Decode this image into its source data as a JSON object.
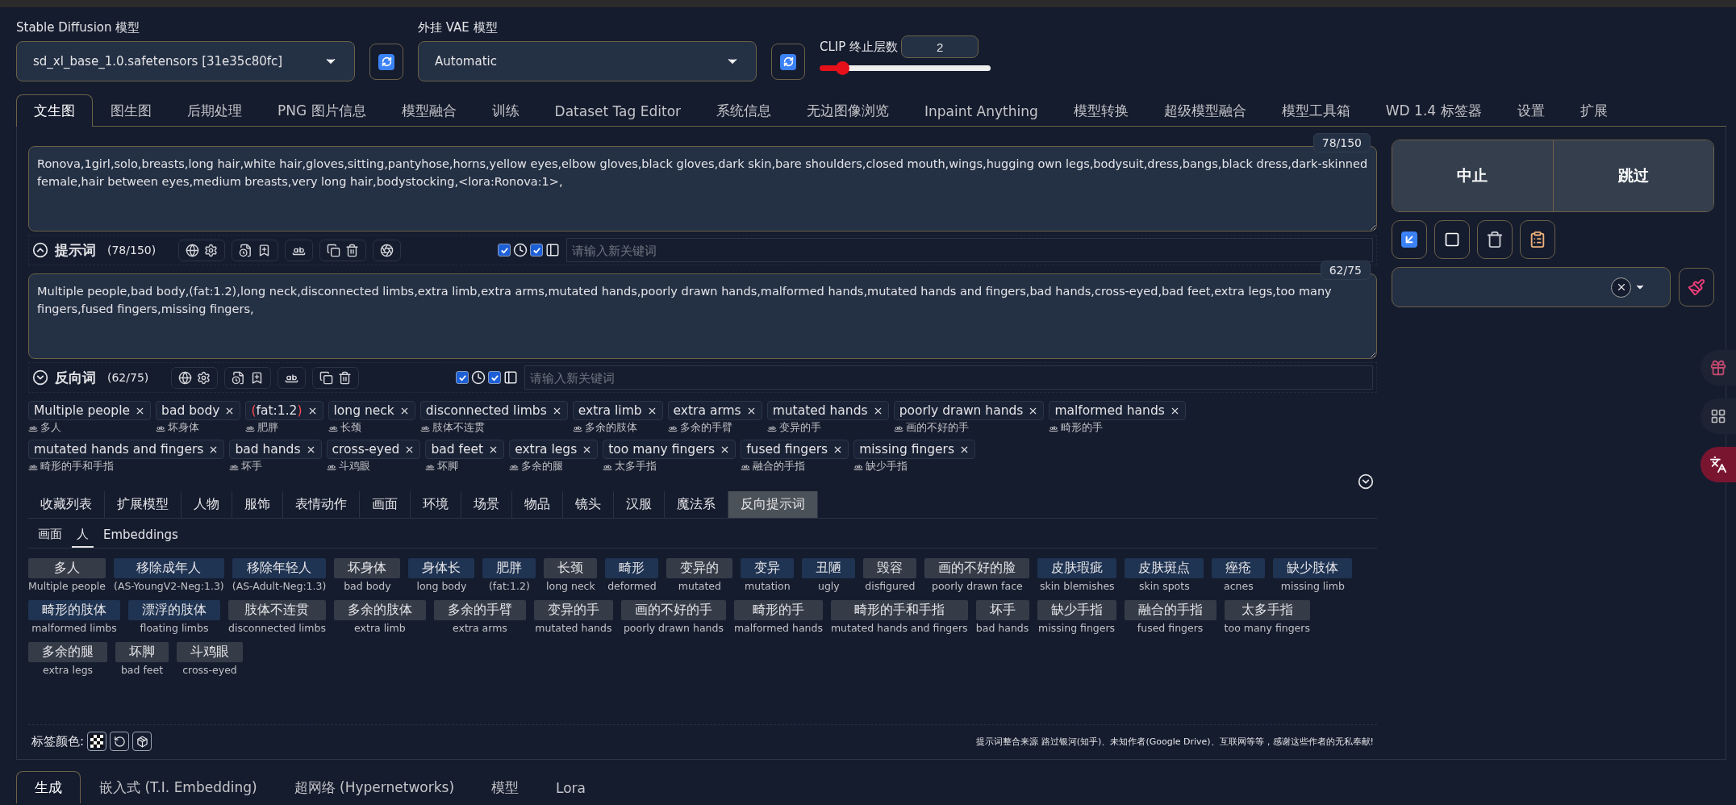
{
  "models": [
    {
      "label": "Stable Diffusion 模型",
      "value": "sd_xl_base_1.0.safetensors [31e35c80fc]"
    },
    {
      "label": "外挂 VAE 模型",
      "value": "Automatic"
    }
  ],
  "clip": {
    "label": "CLIP 终止层数",
    "value": "2",
    "level": 0.1
  },
  "tabs": [
    {
      "label": "文生图",
      "selected": true
    },
    {
      "label": "图生图",
      "selected": false
    },
    {
      "label": "后期处理",
      "selected": false
    },
    {
      "label": "PNG 图片信息",
      "selected": false
    },
    {
      "label": "模型融合",
      "selected": false
    },
    {
      "label": "训练",
      "selected": false
    },
    {
      "label": "Dataset Tag Editor",
      "selected": false
    },
    {
      "label": "系统信息",
      "selected": false
    },
    {
      "label": "无边图像浏览",
      "selected": false
    },
    {
      "label": "Inpaint Anything",
      "selected": false
    },
    {
      "label": "模型转换",
      "selected": false
    },
    {
      "label": "超级模型融合",
      "selected": false
    },
    {
      "label": "模型工具箱",
      "selected": false
    },
    {
      "label": "WD 1.4 标签器",
      "selected": false
    },
    {
      "label": "设置",
      "selected": false
    },
    {
      "label": "扩展",
      "selected": false
    }
  ],
  "prompts": [
    {
      "text": "Ronova,1girl,solo,breasts,long hair,white hair,gloves,sitting,pantyhose,horns,yellow eyes,elbow gloves,black gloves,dark skin,bare shoulders,closed mouth,wings,hugging own legs,bodysuit,dress,bangs,black dress,dark-skinned female,hair between eyes,medium breasts,very long hair,bodystocking,<lora:Ronova:1>,",
      "counter": "78/150",
      "title": "提示词",
      "count": "(78/150)",
      "expanded": true,
      "tool_groups": [
        [
          {
            "kind": "globe"
          },
          {
            "kind": "gear"
          }
        ],
        [
          {
            "kind": "history"
          },
          {
            "kind": "bookmark"
          }
        ],
        [
          {
            "kind": "ab"
          }
        ],
        [
          {
            "kind": "copy"
          },
          {
            "kind": "trash"
          }
        ],
        [
          {
            "kind": "openai"
          }
        ]
      ],
      "toggles": [
        {
          "kind": "clock",
          "checked": true
        },
        {
          "kind": "panel",
          "checked": true
        }
      ],
      "placeholder": "请输入新关键词"
    },
    {
      "text": "Multiple people,bad body,(fat:1.2),long neck,disconnected limbs,extra limb,extra arms,mutated hands,poorly drawn hands,malformed hands,mutated hands and fingers,bad hands,cross-eyed,bad feet,extra legs,too many fingers,fused fingers,missing fingers,",
      "counter": "62/75",
      "title": "反向词",
      "count": "(62/75)",
      "expanded": false,
      "tool_groups": [
        [
          {
            "kind": "globe"
          },
          {
            "kind": "gear"
          }
        ],
        [
          {
            "kind": "history"
          },
          {
            "kind": "bookmark"
          }
        ],
        [
          {
            "kind": "ab"
          }
        ],
        [
          {
            "kind": "copy"
          },
          {
            "kind": "trash"
          }
        ]
      ],
      "toggles": [
        {
          "kind": "clock",
          "checked": true
        },
        {
          "kind": "panel",
          "checked": true
        }
      ],
      "placeholder": "请输入新关键词"
    }
  ],
  "tags": [
    {
      "text": "Multiple people",
      "translation": "多人",
      "weighted": false
    },
    {
      "text": "bad body",
      "translation": "坏身体",
      "weighted": false
    },
    {
      "text": "(fat:1.2)",
      "translation": "肥胖",
      "weighted": true
    },
    {
      "text": "long neck",
      "translation": "长颈",
      "weighted": false
    },
    {
      "text": "disconnected limbs",
      "translation": "肢体不连贯",
      "weighted": false
    },
    {
      "text": "extra limb",
      "translation": "多余的肢体",
      "weighted": false
    },
    {
      "text": "extra arms",
      "translation": "多余的手臂",
      "weighted": false
    },
    {
      "text": "mutated hands",
      "translation": "变异的手",
      "weighted": false
    },
    {
      "text": "poorly drawn hands",
      "translation": "画的不好的手",
      "weighted": false
    },
    {
      "text": "malformed hands",
      "translation": "畸形的手",
      "weighted": false
    },
    {
      "text": "mutated hands and fingers",
      "translation": "畸形的手和手指",
      "weighted": false
    },
    {
      "text": "bad hands",
      "translation": "坏手",
      "weighted": false
    },
    {
      "text": "cross-eyed",
      "translation": "斗鸡眼",
      "weighted": false
    },
    {
      "text": "bad feet",
      "translation": "坏脚",
      "weighted": false
    },
    {
      "text": "extra legs",
      "translation": "多余的腿",
      "weighted": false
    },
    {
      "text": "too many fingers",
      "translation": "太多手指",
      "weighted": false
    },
    {
      "text": "fused fingers",
      "translation": "融合的手指",
      "weighted": false
    },
    {
      "text": "missing fingers",
      "translation": "缺少手指",
      "weighted": false
    }
  ],
  "categories": [
    {
      "label": "收藏列表",
      "selected": false
    },
    {
      "label": "扩展模型",
      "selected": false
    },
    {
      "label": "人物",
      "selected": false
    },
    {
      "label": "服饰",
      "selected": false
    },
    {
      "label": "表情动作",
      "selected": false
    },
    {
      "label": "画面",
      "selected": false
    },
    {
      "label": "环境",
      "selected": false
    },
    {
      "label": "场景",
      "selected": false
    },
    {
      "label": "物品",
      "selected": false
    },
    {
      "label": "镜头",
      "selected": false
    },
    {
      "label": "汉服",
      "selected": false
    },
    {
      "label": "魔法系",
      "selected": false
    },
    {
      "label": "反向提示词",
      "selected": true
    }
  ],
  "subtabs": [
    {
      "label": "画面",
      "selected": false
    },
    {
      "label": "人",
      "selected": true
    },
    {
      "label": "Embeddings",
      "selected": false
    }
  ],
  "grid": [
    {
      "label": "多人",
      "translation": "Multiple people",
      "color": "#353c48"
    },
    {
      "label": "移除成年人",
      "translation": "(AS-YoungV2-Neg:1.3)",
      "color": "#1f3352"
    },
    {
      "label": "移除年轻人",
      "translation": "(AS-Adult-Neg:1.3)",
      "color": "#1f3352"
    },
    {
      "label": "坏身体",
      "translation": "bad body",
      "color": "#353c48"
    },
    {
      "label": "身体长",
      "translation": "long body",
      "color": "#1f3352"
    },
    {
      "label": "肥胖",
      "translation": "(fat:1.2)",
      "color": "#1f3352"
    },
    {
      "label": "长颈",
      "translation": "long neck",
      "color": "#353c48"
    },
    {
      "label": "畸形",
      "translation": "deformed",
      "color": "#1f3352"
    },
    {
      "label": "变异的",
      "translation": "mutated",
      "color": "#353c48"
    },
    {
      "label": "变异",
      "translation": "mutation",
      "color": "#1f3352"
    },
    {
      "label": "丑陋",
      "translation": "ugly",
      "color": "#1f3352"
    },
    {
      "label": "毁容",
      "translation": "disfigured",
      "color": "#353c48"
    },
    {
      "label": "画的不好的脸",
      "translation": "poorly drawn face",
      "color": "#353c48"
    },
    {
      "label": "皮肤瑕疵",
      "translation": "skin blemishes",
      "color": "#1f3352"
    },
    {
      "label": "皮肤斑点",
      "translation": "skin spots",
      "color": "#1f3352"
    },
    {
      "label": "痤疮",
      "translation": "acnes",
      "color": "#1f3352"
    },
    {
      "label": "缺少肢体",
      "translation": "missing limb",
      "color": "#1f3352"
    },
    {
      "label": "畸形的肢体",
      "translation": "malformed limbs",
      "color": "#1f3352"
    },
    {
      "label": "漂浮的肢体",
      "translation": "floating limbs",
      "color": "#1f3352"
    },
    {
      "label": "肢体不连贯",
      "translation": "disconnected limbs",
      "color": "#353c48"
    },
    {
      "label": "多余的肢体",
      "translation": "extra limb",
      "color": "#353c48"
    },
    {
      "label": "多余的手臂",
      "translation": "extra arms",
      "color": "#353c48"
    },
    {
      "label": "变异的手",
      "translation": "mutated hands",
      "color": "#353c48"
    },
    {
      "label": "画的不好的手",
      "translation": "poorly drawn hands",
      "color": "#353c48"
    },
    {
      "label": "畸形的手",
      "translation": "malformed hands",
      "color": "#353c48"
    },
    {
      "label": "畸形的手和手指",
      "translation": "mutated hands and fingers",
      "color": "#353c48"
    },
    {
      "label": "坏手",
      "translation": "bad hands",
      "color": "#353c48"
    },
    {
      "label": "缺少手指",
      "translation": "missing fingers",
      "color": "#353c48"
    },
    {
      "label": "融合的手指",
      "translation": "fused fingers",
      "color": "#353c48"
    },
    {
      "label": "太多手指",
      "translation": "too many fingers",
      "color": "#353c48"
    },
    {
      "label": "多余的腿",
      "translation": "extra legs",
      "color": "#353c48"
    },
    {
      "label": "坏脚",
      "translation": "bad feet",
      "color": "#353c48"
    },
    {
      "label": "斗鸡眼",
      "translation": "cross-eyed",
      "color": "#353c48"
    }
  ],
  "footer": {
    "label": "标签颜色:",
    "note": "提示词整合来源 路过银河(知乎)、未知作者(Google Drive)、互联网等等，感谢这些作者的无私奉献!"
  },
  "bottom_tabs": [
    {
      "label": "生成",
      "selected": true
    },
    {
      "label": "嵌入式 (T.I. Embedding)",
      "selected": false
    },
    {
      "label": "超网络 (Hypernetworks)",
      "selected": false
    },
    {
      "label": "模型",
      "selected": false
    },
    {
      "label": "Lora",
      "selected": false
    }
  ],
  "actions": [
    {
      "label": "中止"
    },
    {
      "label": "跳过"
    }
  ]
}
